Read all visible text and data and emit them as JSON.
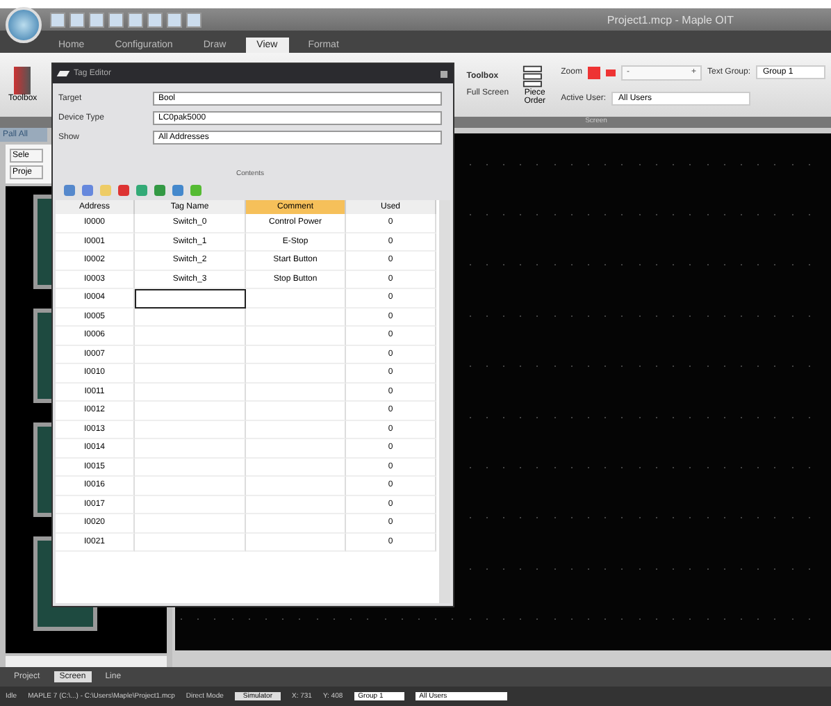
{
  "window": {
    "title": "Project1.mcp - Maple OIT"
  },
  "menu_tabs": [
    {
      "label": "Home",
      "selected": false
    },
    {
      "label": "Configuration",
      "selected": false
    },
    {
      "label": "Draw",
      "selected": false
    },
    {
      "label": "View",
      "selected": true
    },
    {
      "label": "Format",
      "selected": false
    }
  ],
  "ribbon": {
    "toolbox": "Toolbox",
    "panel_a": "Toolbox",
    "panel_b": "Full Screen",
    "place_order": "Piece Order",
    "zoom_label": "Zoom",
    "zoom_minus": "-",
    "zoom_plus": "+",
    "text_group_label": "Text Group:",
    "text_group_value": "Group 1",
    "active_user_label": "Active User:",
    "active_user_value": "All Users",
    "section_label": "Screen"
  },
  "left_panel": {
    "tab": "Pall All",
    "items": [
      "Sele",
      "Proje"
    ],
    "bottom_tabs": [
      {
        "label": "Project",
        "selected": false
      },
      {
        "label": "Screen",
        "selected": true
      },
      {
        "label": "Line",
        "selected": false
      }
    ]
  },
  "tag_editor": {
    "title": "Tag Editor",
    "fields": [
      {
        "label": "Target",
        "value": "Bool"
      },
      {
        "label": "Device Type",
        "value": "LC0pak5000"
      },
      {
        "label": "Show",
        "value": "All Addresses"
      }
    ],
    "splitter": "Contents",
    "columns": [
      "Address",
      "Tag Name",
      "Comment",
      "Used"
    ],
    "rows": [
      {
        "address": "I0000",
        "tag": "Switch_0",
        "comment": "Control Power",
        "used": "0",
        "selected": false
      },
      {
        "address": "I0001",
        "tag": "Switch_1",
        "comment": "E-Stop",
        "used": "0",
        "selected": false
      },
      {
        "address": "I0002",
        "tag": "Switch_2",
        "comment": "Start Button",
        "used": "0",
        "selected": false
      },
      {
        "address": "I0003",
        "tag": "Switch_3",
        "comment": "Stop Button",
        "used": "0",
        "selected": false
      },
      {
        "address": "I0004",
        "tag": "",
        "comment": "",
        "used": "0",
        "selected": true
      },
      {
        "address": "I0005",
        "tag": "",
        "comment": "",
        "used": "0",
        "selected": false
      },
      {
        "address": "I0006",
        "tag": "",
        "comment": "",
        "used": "0",
        "selected": false
      },
      {
        "address": "I0007",
        "tag": "",
        "comment": "",
        "used": "0",
        "selected": false
      },
      {
        "address": "I0010",
        "tag": "",
        "comment": "",
        "used": "0",
        "selected": false
      },
      {
        "address": "I0011",
        "tag": "",
        "comment": "",
        "used": "0",
        "selected": false
      },
      {
        "address": "I0012",
        "tag": "",
        "comment": "",
        "used": "0",
        "selected": false
      },
      {
        "address": "I0013",
        "tag": "",
        "comment": "",
        "used": "0",
        "selected": false
      },
      {
        "address": "I0014",
        "tag": "",
        "comment": "",
        "used": "0",
        "selected": false
      },
      {
        "address": "I0015",
        "tag": "",
        "comment": "",
        "used": "0",
        "selected": false
      },
      {
        "address": "I0016",
        "tag": "",
        "comment": "",
        "used": "0",
        "selected": false
      },
      {
        "address": "I0017",
        "tag": "",
        "comment": "",
        "used": "0",
        "selected": false
      },
      {
        "address": "I0020",
        "tag": "",
        "comment": "",
        "used": "0",
        "selected": false
      },
      {
        "address": "I0021",
        "tag": "",
        "comment": "",
        "used": "0",
        "selected": false
      }
    ]
  },
  "status_bar": {
    "state": "Idle",
    "path": "MAPLE 7 (C:\\...) - C:\\Users\\Maple\\Project1.mcp",
    "mode": "Direct Mode",
    "button": "Simulator",
    "x": "X: 731",
    "y": "Y: 408",
    "group": "Group 1",
    "user": "All Users"
  }
}
